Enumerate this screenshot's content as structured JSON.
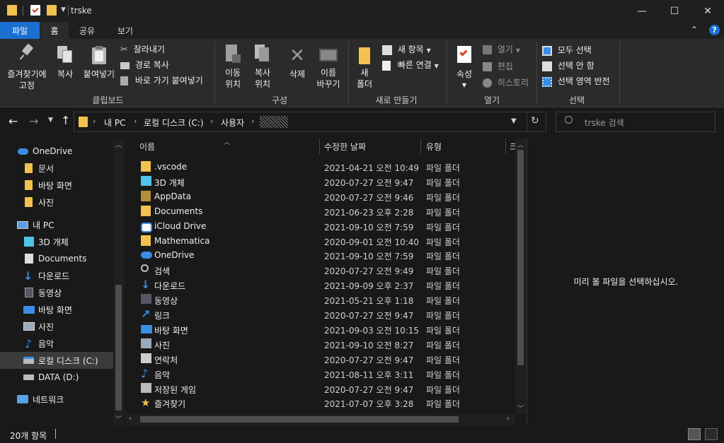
{
  "window": {
    "title": "trske",
    "minimize": "—",
    "maximize": "☐",
    "close": "✕"
  },
  "tabs": [
    "파일",
    "홈",
    "공유",
    "보기"
  ],
  "ribbon": {
    "clipboard": {
      "pin": "즐겨찾기에\n고정",
      "copy": "복사",
      "paste": "붙여넣기",
      "cut": "잘라내기",
      "copy_path": "경로 복사",
      "paste_shortcut": "바로 가기 붙여넣기",
      "title": "클립보드"
    },
    "organize": {
      "move_to": "이동\n위치",
      "copy_to": "복사\n위치",
      "delete": "삭제",
      "rename": "이름\n바꾸기",
      "title": "구성"
    },
    "new": {
      "new_folder": "새\n폴더",
      "new_item": "새 항목",
      "easy_access": "빠른 연결",
      "title": "새로 만들기"
    },
    "open": {
      "properties": "속성",
      "open": "열기",
      "edit": "편집",
      "history": "히스토리",
      "title": "열기"
    },
    "select": {
      "select_all": "모두 선택",
      "select_none": "선택 안 함",
      "invert": "선택 영역 반전",
      "title": "선택"
    }
  },
  "address": {
    "crumbs": [
      "내 PC",
      "로컬 디스크 (C:)",
      "사용자"
    ],
    "search_placeholder": "trske 검색"
  },
  "nav": [
    {
      "label": "OneDrive",
      "icon": "cloud-icon"
    },
    {
      "label": "문서",
      "icon": "folder-icon"
    },
    {
      "label": "바탕 화면",
      "icon": "folder-icon"
    },
    {
      "label": "사진",
      "icon": "folder-icon"
    },
    {
      "label": "내 PC",
      "icon": "computer-icon"
    },
    {
      "label": "3D 개체",
      "icon": "cube-icon"
    },
    {
      "label": "Documents",
      "icon": "document-icon"
    },
    {
      "label": "다운로드",
      "icon": "download-icon"
    },
    {
      "label": "동영상",
      "icon": "video-icon"
    },
    {
      "label": "바탕 화면",
      "icon": "desktop-icon"
    },
    {
      "label": "사진",
      "icon": "picture-icon"
    },
    {
      "label": "음악",
      "icon": "music-icon"
    },
    {
      "label": "로컬 디스크 (C:)",
      "icon": "drive-icon"
    },
    {
      "label": "DATA (D:)",
      "icon": "drive-icon"
    },
    {
      "label": "네트워크",
      "icon": "network-icon"
    }
  ],
  "columns": {
    "name": "이름",
    "modified": "수정한 날짜",
    "type": "유형",
    "size": "크"
  },
  "files": [
    {
      "name": ".vscode",
      "date": "2021-04-21 오전 10:49",
      "type": "파일 폴더",
      "icon": "folder-icon"
    },
    {
      "name": "3D 개체",
      "date": "2020-07-27 오전 9:47",
      "type": "파일 폴더",
      "icon": "cube-icon"
    },
    {
      "name": "AppData",
      "date": "2020-07-27 오전 9:46",
      "type": "파일 폴더",
      "icon": "folder-icon"
    },
    {
      "name": "Documents",
      "date": "2021-06-23 오후 2:28",
      "type": "파일 폴더",
      "icon": "folder-icon"
    },
    {
      "name": "iCloud Drive",
      "date": "2021-09-10 오전 7:59",
      "type": "파일 폴더",
      "icon": "icloud-icon"
    },
    {
      "name": "Mathematica",
      "date": "2020-09-01 오전 10:40",
      "type": "파일 폴더",
      "icon": "folder-icon"
    },
    {
      "name": "OneDrive",
      "date": "2021-09-10 오전 7:59",
      "type": "파일 폴더",
      "icon": "cloud-icon"
    },
    {
      "name": "검색",
      "date": "2020-07-27 오전 9:49",
      "type": "파일 폴더",
      "icon": "search-icon"
    },
    {
      "name": "다운로드",
      "date": "2021-09-09 오후 2:37",
      "type": "파일 폴더",
      "icon": "download-icon"
    },
    {
      "name": "동영상",
      "date": "2021-05-21 오후 1:18",
      "type": "파일 폴더",
      "icon": "video-icon"
    },
    {
      "name": "링크",
      "date": "2020-07-27 오전 9:47",
      "type": "파일 폴더",
      "icon": "link-icon"
    },
    {
      "name": "바탕 화면",
      "date": "2021-09-03 오전 10:15",
      "type": "파일 폴더",
      "icon": "desktop-icon"
    },
    {
      "name": "사진",
      "date": "2021-09-10 오전 8:27",
      "type": "파일 폴더",
      "icon": "picture-icon"
    },
    {
      "name": "연락처",
      "date": "2020-07-27 오전 9:47",
      "type": "파일 폴더",
      "icon": "contacts-icon"
    },
    {
      "name": "음악",
      "date": "2021-08-11 오후 3:11",
      "type": "파일 폴더",
      "icon": "music-icon"
    },
    {
      "name": "저장된 게임",
      "date": "2020-07-27 오전 9:47",
      "type": "파일 폴더",
      "icon": "game-icon"
    },
    {
      "name": "즐겨찾기",
      "date": "2021-07-07 오후 3:28",
      "type": "파일 폴더",
      "icon": "star-icon"
    }
  ],
  "preview": {
    "message": "미리 볼 파일을 선택하십시오."
  },
  "status": {
    "count": "20개 항목"
  },
  "colors": {
    "accent": "#0078d7",
    "folder": "#f2c14e",
    "blue_icon": "#3a8ee6"
  }
}
